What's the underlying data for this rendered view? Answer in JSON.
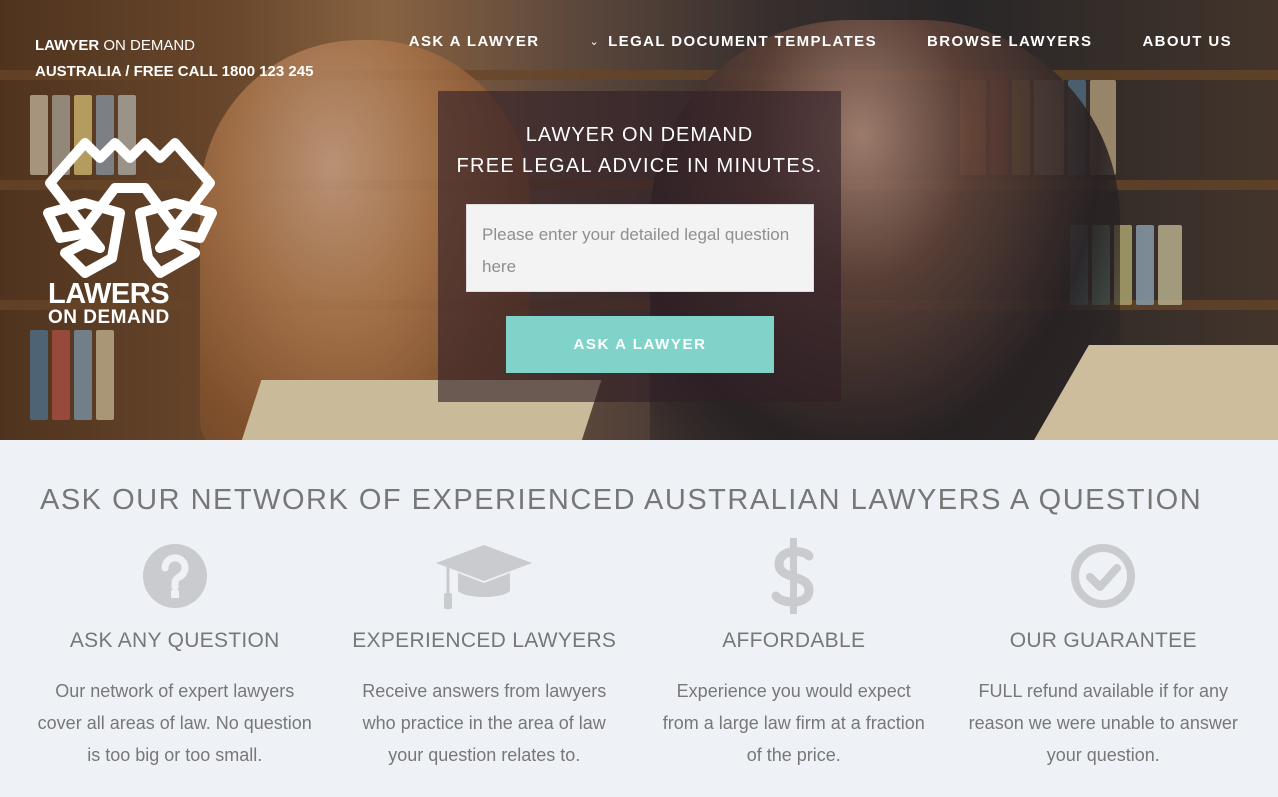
{
  "header": {
    "brand_strong": "LAWYER",
    "brand_rest": "ON DEMAND",
    "tagline": "AUSTRALIA / FREE CALL 1800 123 245"
  },
  "nav": {
    "items": [
      {
        "label": "ASK A LAWYER"
      },
      {
        "label": "LEGAL DOCUMENT TEMPLATES"
      },
      {
        "label": "BROWSE LAWYERS"
      },
      {
        "label": "ABOUT US"
      }
    ]
  },
  "logo": {
    "line1": "LAWERS",
    "line2": "ON DEMAND"
  },
  "hero": {
    "title": "LAWYER ON DEMAND",
    "subtitle": "FREE LEGAL ADVICE IN MINUTES.",
    "question_placeholder": "Please enter your detailed legal question here",
    "button_label": "ASK A LAWYER"
  },
  "section": {
    "title": "ASK OUR NETWORK OF EXPERIENCED AUSTRALIAN LAWYERS A QUESTION"
  },
  "features": [
    {
      "icon": "question-circle-icon",
      "title": "ASK ANY QUESTION",
      "text": "Our network of expert lawyers cover all areas of law. No question is too big or too small."
    },
    {
      "icon": "graduation-cap-icon",
      "title": "EXPERIENCED LAWYERS",
      "text": "Receive answers from lawyers who practice in the area of law your question relates to."
    },
    {
      "icon": "dollar-icon",
      "title": "AFFORDABLE",
      "text": "Experience you would expect from a large law firm at a fraction of the price."
    },
    {
      "icon": "check-circle-icon",
      "title": "OUR GUARANTEE",
      "text": "FULL refund available if for any reason we were unable to answer your question."
    }
  ],
  "colors": {
    "accent": "#7fd3c8",
    "icon_gray": "#c9cbcf",
    "text_gray": "#777777",
    "lower_bg": "#eef2f7"
  }
}
